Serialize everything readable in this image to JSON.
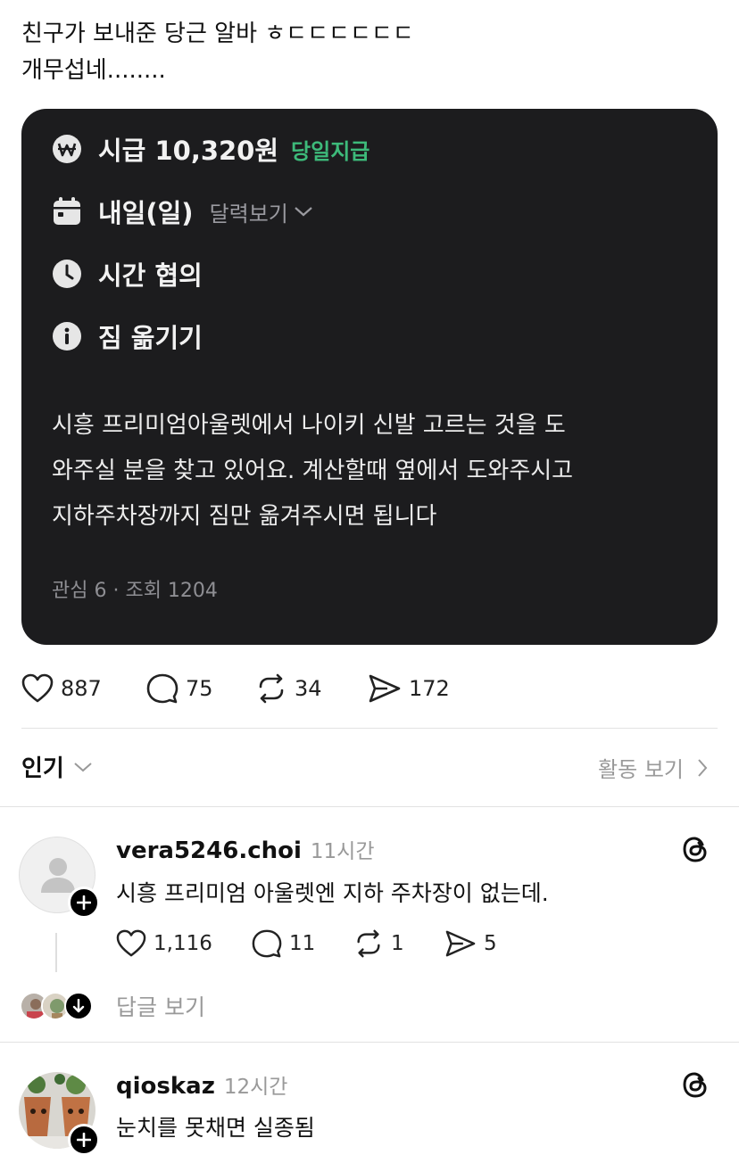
{
  "post": {
    "line1": "친구가 보내준 당근 알바 ㅎㄷㄷㄷㄷㄷㄷ",
    "line2": "개무섭네........"
  },
  "card": {
    "wage_title": "시급 10,320원",
    "wage_tag": "당일지급",
    "date_title": "내일(일)",
    "date_link": "달력보기",
    "time_title": "시간 협의",
    "task_title": "짐 옮기기",
    "description_lines": [
      "시흥 프리미엄아울렛에서 나이키 신발 고르는 것을 도",
      "와주실 분을 찾고 있어요. 계산할때 옆에서 도와주시고",
      "지하주차장까지 짐만 옮겨주시면 됩니다"
    ],
    "meta": "관심 6 · 조회 1204",
    "accent_color": "#3dba7a",
    "background_color": "#1c1c1e"
  },
  "post_actions": {
    "likes": "887",
    "comments": "75",
    "reposts": "34",
    "shares": "172"
  },
  "replies_header": {
    "sort_label": "인기",
    "activity_link": "활동 보기"
  },
  "comments": [
    {
      "username": "vera5246.choi",
      "time": "11시간",
      "text": "시흥 프리미엄 아울렛엔 지하 주차장이 없는데.",
      "likes": "1,116",
      "comments": "11",
      "reposts": "1",
      "shares": "5",
      "view_replies": "답글 보기"
    },
    {
      "username": "qioskaz",
      "time": "12시간",
      "text": "눈치를 못채면 실종됨"
    }
  ]
}
